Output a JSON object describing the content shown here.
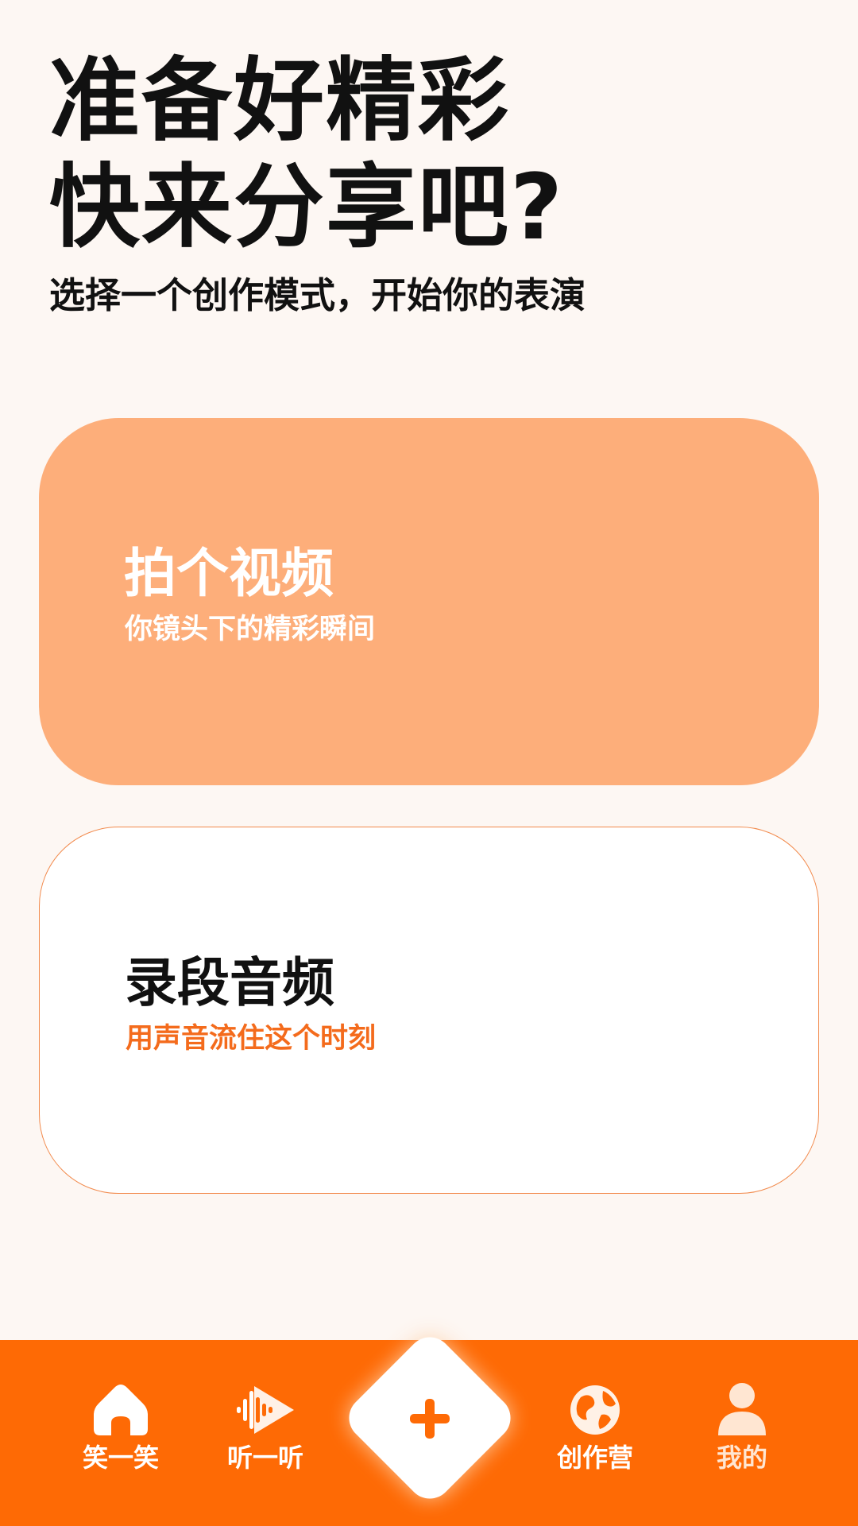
{
  "header": {
    "title_line1": "准备好精彩",
    "title_line2": "快来分享吧?",
    "subtitle": "选择一个创作模式，开始你的表演"
  },
  "cards": [
    {
      "title": "拍个视频",
      "description": "你镜头下的精彩瞬间",
      "background": "#fdae7a"
    },
    {
      "title": "录段音频",
      "description": "用声音流住这个时刻",
      "background": "#ffffff",
      "accent": "#f46b1c"
    }
  ],
  "tabbar": {
    "background": "#fe6a05",
    "items": [
      {
        "label": "笑一笑",
        "icon": "home-icon"
      },
      {
        "label": "听一听",
        "icon": "audio-play-icon"
      },
      {
        "label": "",
        "icon": "plus-icon",
        "role": "create-button"
      },
      {
        "label": "创作营",
        "icon": "globe-icon"
      },
      {
        "label": "我的",
        "icon": "user-icon"
      }
    ]
  },
  "colors": {
    "page_background": "#fdf7f3",
    "brand_orange": "#fe6a05",
    "card_video": "#fdae7a",
    "text_dark": "#111111"
  }
}
